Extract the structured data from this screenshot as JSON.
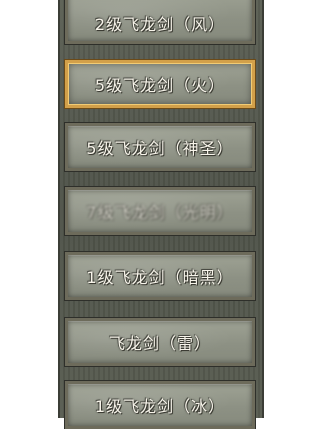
{
  "items": [
    {
      "label": "2级飞龙剑（风）",
      "selected": false
    },
    {
      "label": "5级飞龙剑（火）",
      "selected": true
    },
    {
      "label": "5级飞龙剑（神圣）",
      "selected": false
    },
    {
      "label": "7级飞龙剑（光明）",
      "selected": false
    },
    {
      "label": "1级飞龙剑（暗黑）",
      "selected": false
    },
    {
      "label": "飞龙剑（雷）",
      "selected": false
    },
    {
      "label": "1级飞龙剑（冰）",
      "selected": false
    }
  ],
  "colors": {
    "panel": "#52564c",
    "item_face": "#8f9386",
    "item_border": "#6d6b5b",
    "selected_border": "#d2a04a",
    "label_text": "#f7f4ea"
  }
}
